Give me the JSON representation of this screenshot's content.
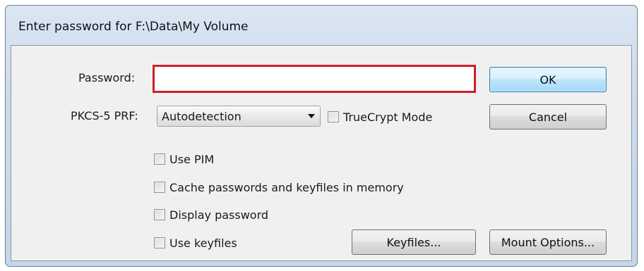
{
  "window": {
    "title": "Enter password for F:\\Data\\My Volume"
  },
  "password": {
    "label": "Password:",
    "value": ""
  },
  "prf": {
    "label": "PKCS-5 PRF:",
    "selected": "Autodetection"
  },
  "options": {
    "truecrypt_mode": {
      "label": "TrueCrypt Mode",
      "checked": false
    },
    "use_pim": {
      "label": "Use PIM",
      "checked": false
    },
    "cache": {
      "label": "Cache passwords and keyfiles in memory",
      "checked": false
    },
    "display_password": {
      "label": "Display password",
      "checked": false
    },
    "use_keyfiles": {
      "label": "Use keyfiles",
      "checked": false
    }
  },
  "buttons": {
    "ok": "OK",
    "cancel": "Cancel",
    "keyfiles": "Keyfiles...",
    "mount_options": "Mount Options..."
  },
  "colors": {
    "highlight_border": "#cc1f2b",
    "default_button": "#bee6fd",
    "dialog_bg": "#f0f0f0"
  }
}
